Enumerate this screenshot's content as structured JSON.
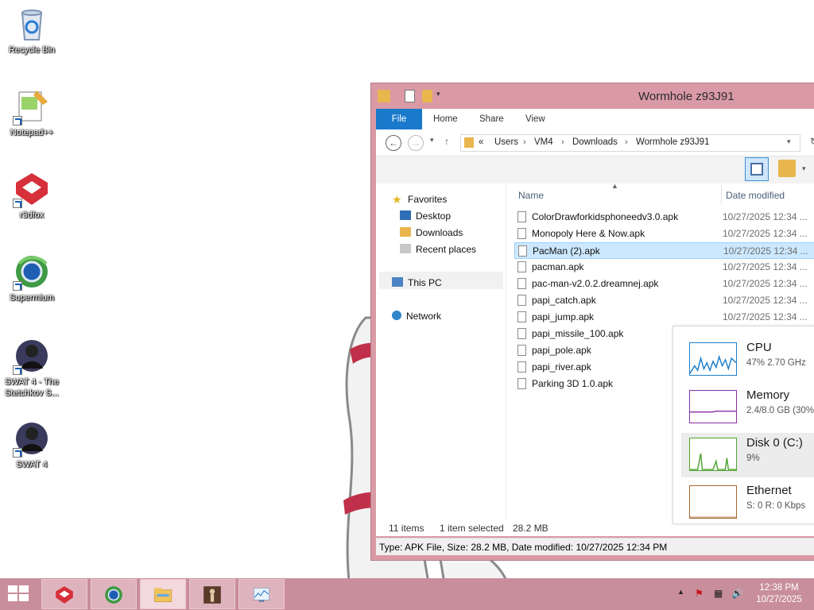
{
  "desktop": {
    "icons": [
      {
        "label": "Recycle Bin"
      },
      {
        "label": "Notepad++"
      },
      {
        "label": "r3dfox"
      },
      {
        "label": "Supermium"
      },
      {
        "label": "SWAT 4 - The Stetchkov S..."
      },
      {
        "label": "SWAT 4"
      }
    ]
  },
  "explorer": {
    "title": "Wormhole z93J91",
    "ribbon_tabs": [
      "File",
      "Home",
      "Share",
      "View"
    ],
    "address": {
      "overflow": "«",
      "crumbs": [
        "Users",
        "VM4",
        "Downloads",
        "Wormhole z93J91"
      ],
      "sep": "›"
    },
    "nav": {
      "favorites": "Favorites",
      "desktop": "Desktop",
      "downloads": "Downloads",
      "recent": "Recent places",
      "this_pc": "This PC",
      "network": "Network"
    },
    "columns": {
      "name": "Name",
      "date": "Date modified"
    },
    "files": [
      {
        "name": "ColorDrawforkidsphoneedv3.0.apk",
        "date": "10/27/2025 12:34 ..."
      },
      {
        "name": "Monopoly Here & Now.apk",
        "date": "10/27/2025 12:34 ..."
      },
      {
        "name": "PacMan (2).apk",
        "date": "10/27/2025 12:34 ...",
        "selected": true
      },
      {
        "name": "pacman.apk",
        "date": "10/27/2025 12:34 ..."
      },
      {
        "name": "pac-man-v2.0.2.dreamnej.apk",
        "date": "10/27/2025 12:34 ..."
      },
      {
        "name": "papi_catch.apk",
        "date": "10/27/2025 12:34 ..."
      },
      {
        "name": "papi_jump.apk",
        "date": "10/27/2025 12:34 ..."
      },
      {
        "name": "papi_missile_100.apk",
        "date": ""
      },
      {
        "name": "papi_pole.apk",
        "date": ""
      },
      {
        "name": "papi_river.apk",
        "date": ""
      },
      {
        "name": "Parking 3D 1.0.apk",
        "date": ""
      }
    ],
    "status": {
      "count": "11 items",
      "selected": "1 item selected",
      "size": "28.2 MB"
    },
    "details": "Type: APK File, Size: 28.2 MB, Date modified: 10/27/2025 12:34 PM"
  },
  "performance": {
    "items": [
      {
        "title": "CPU",
        "sub": "47%  2.70 GHz",
        "color": "#1e7ec8"
      },
      {
        "title": "Memory",
        "sub": "2.4/8.0 GB (30%)",
        "color": "#8b2fa6"
      },
      {
        "title": "Disk 0 (C:)",
        "sub": "9%",
        "color": "#4fa331"
      },
      {
        "title": "Ethernet",
        "sub": "S: 0  R: 0 Kbps",
        "color": "#a7652c"
      }
    ]
  },
  "taskbar": {
    "time": "12:38 PM",
    "date": "10/27/2025",
    "accent": "#c98e9b"
  }
}
